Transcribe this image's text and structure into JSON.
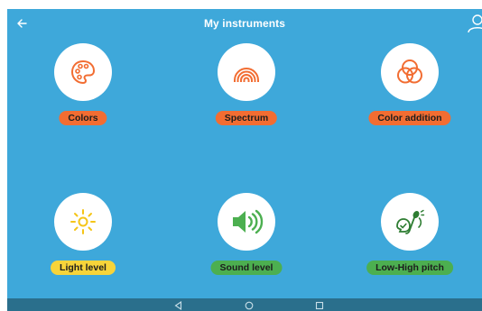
{
  "app": {
    "title": "My instruments",
    "background": "#3ea8da"
  },
  "header": {
    "back_icon": "arrow-left-icon",
    "profile_icon": "user-icon"
  },
  "instruments": [
    {
      "label": "Colors",
      "icon": "palette-icon",
      "color": "#f26d32"
    },
    {
      "label": "Spectrum",
      "icon": "rainbow-icon",
      "color": "#f26d32"
    },
    {
      "label": "Color addition",
      "icon": "color-circles-icon",
      "color": "#f26d32"
    },
    {
      "label": "Light level",
      "icon": "sun-icon",
      "color": "#f7d43a"
    },
    {
      "label": "Sound level",
      "icon": "speaker-icon",
      "color": "#4caf50"
    },
    {
      "label": "Low-High pitch",
      "icon": "singer-icon",
      "color": "#4caf50"
    }
  ],
  "system_nav": {
    "background": "#2a6f8c",
    "buttons": [
      "back-triangle-icon",
      "home-circle-icon",
      "recents-square-icon"
    ]
  }
}
